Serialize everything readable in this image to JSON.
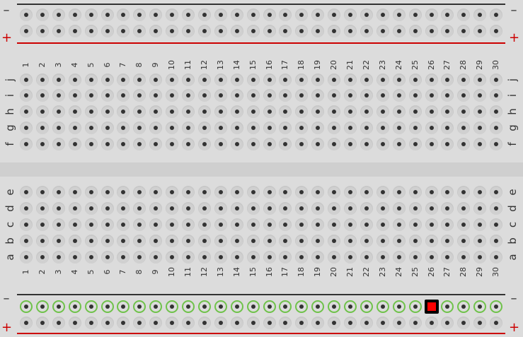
{
  "board": {
    "rail_top": {
      "minus_label": "–",
      "plus_label": "+"
    },
    "rail_bottom": {
      "minus_label": "–",
      "plus_label": "+"
    },
    "columns": [
      "1",
      "2",
      "3",
      "4",
      "5",
      "6",
      "7",
      "8",
      "9",
      "10",
      "11",
      "12",
      "13",
      "14",
      "15",
      "16",
      "17",
      "18",
      "19",
      "20",
      "21",
      "22",
      "23",
      "24",
      "25",
      "26",
      "27",
      "28",
      "29",
      "30"
    ],
    "rows_top": [
      "j",
      "i",
      "h",
      "g",
      "f"
    ],
    "rows_bottom": [
      "e",
      "d",
      "c",
      "b",
      "a"
    ],
    "rail_columns": 30,
    "highlighted_rail_row": "bottom-minus",
    "active_hole": {
      "rail": "bottom-minus",
      "column": 26
    }
  },
  "colors": {
    "minus_line": "#333333",
    "plus_line": "#cc0000",
    "highlight": "#6fc24a",
    "active": "#ff0000"
  }
}
